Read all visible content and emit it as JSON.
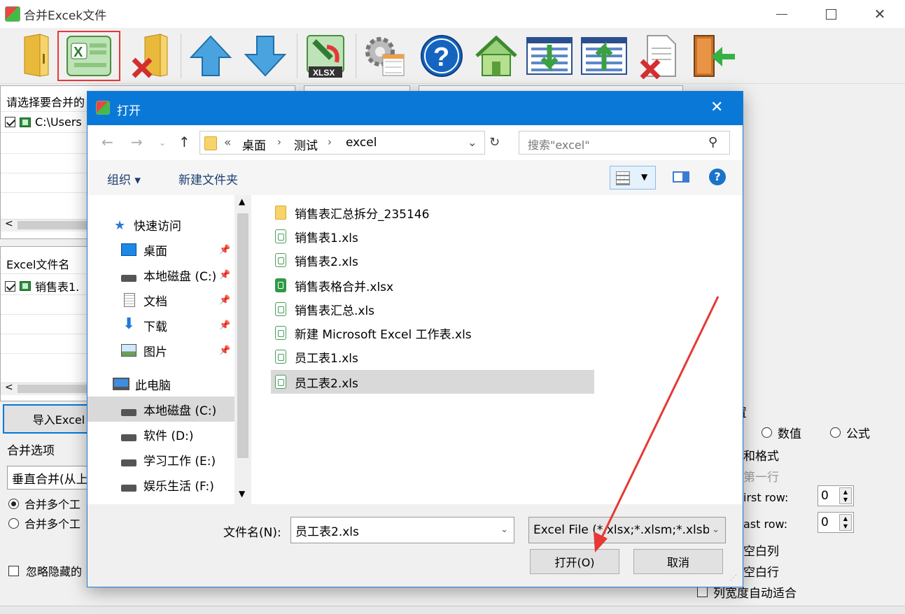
{
  "window": {
    "title": "合并Excek文件",
    "minimize_icon": "minimize-icon",
    "maximize_icon": "maximize-icon",
    "close_icon": "close-icon"
  },
  "toolbar": {
    "items": [
      {
        "name": "open-folder-icon"
      },
      {
        "name": "excel-add-icon"
      },
      {
        "name": "remove-folder-icon"
      },
      {
        "name": "move-up-icon"
      },
      {
        "name": "move-down-icon"
      },
      {
        "name": "xlsx-convert-icon"
      },
      {
        "name": "settings-icon"
      },
      {
        "name": "help-icon"
      },
      {
        "name": "home-icon"
      },
      {
        "name": "list-import-icon"
      },
      {
        "name": "list-export-icon"
      },
      {
        "name": "delete-file-icon"
      },
      {
        "name": "exit-icon"
      }
    ]
  },
  "left_panel": {
    "top_label": "请选择要合并的",
    "top_item": "C:\\Users",
    "bottom_label": "Excel文件名",
    "bottom_item": "销售表1.",
    "import_button": "导入Excel",
    "merge_options_label": "合并选项",
    "merge_combo_value": "垂直合并(从上",
    "radio1": "合并多个工",
    "radio2": "合并多个工",
    "ignore_hidden": "忽略隐藏的"
  },
  "right_panel": {
    "section_label": "置",
    "radio_value": "数值",
    "radio_formula": "公式",
    "with_format": "和格式",
    "first_row_text": "第一行",
    "first_row_label": "irst row:",
    "first_row_value": "0",
    "last_row_label": "ast row:",
    "last_row_value": "0",
    "blank_col": "空白列",
    "blank_row": "空白行",
    "auto_width": "列宽度自动适合"
  },
  "dialog": {
    "title": "打开",
    "breadcrumb": {
      "prefix": "«",
      "parts": [
        "桌面",
        "测试",
        "excel"
      ]
    },
    "search_placeholder": "搜索\"excel\"",
    "organize": "组织 ▾",
    "new_folder": "新建文件夹",
    "nav": {
      "quick_access": "快速访问",
      "items": [
        {
          "label": "桌面",
          "pinned": true
        },
        {
          "label": "本地磁盘 (C:)",
          "pinned": true
        },
        {
          "label": "文档",
          "pinned": true
        },
        {
          "label": "下载",
          "pinned": true
        },
        {
          "label": "图片",
          "pinned": true
        }
      ],
      "this_pc": "此电脑",
      "drives": [
        {
          "label": "本地磁盘 (C:)",
          "selected": true
        },
        {
          "label": "软件 (D:)"
        },
        {
          "label": "学习工作 (E:)"
        },
        {
          "label": "娱乐生活 (F:)"
        }
      ]
    },
    "files": [
      {
        "label": "销售表汇总拆分_235146",
        "icon": "folder-icon"
      },
      {
        "label": "销售表1.xls",
        "icon": "xls-file-icon"
      },
      {
        "label": "销售表2.xls",
        "icon": "xls-file-icon"
      },
      {
        "label": "销售表格合并.xlsx",
        "icon": "xlsx-file-icon"
      },
      {
        "label": "销售表汇总.xls",
        "icon": "xls-file-icon"
      },
      {
        "label": "新建 Microsoft Excel 工作表.xls",
        "icon": "xls-file-icon"
      },
      {
        "label": "员工表1.xls",
        "icon": "xls-file-icon"
      },
      {
        "label": "员工表2.xls",
        "icon": "xls-file-icon",
        "selected": true
      }
    ],
    "filename_label": "文件名(N):",
    "filename_value": "员工表2.xls",
    "filetype_value": "Excel File (*.xlsx;*.xlsm;*.xlsb;",
    "open_button": "打开(O)",
    "cancel_button": "取消"
  },
  "colors": {
    "dialog_titlebar": "#0a78d7",
    "selection": "#d9d9d9",
    "highlight_box": "#e53935",
    "arrow": "#e53935"
  }
}
